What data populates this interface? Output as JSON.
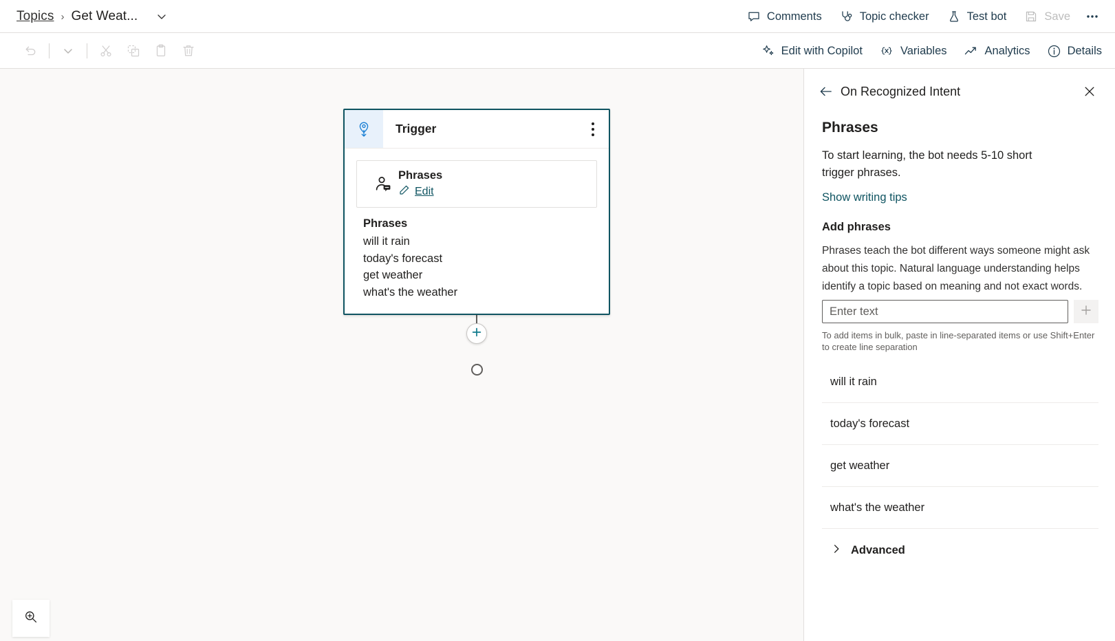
{
  "breadcrumb": {
    "root": "Topics",
    "separator": "›",
    "current": "Get Weat...",
    "chevron_icon": "chevron-down-icon"
  },
  "topbar": {
    "comments": {
      "label": "Comments",
      "icon": "comment-icon"
    },
    "topic_checker": {
      "label": "Topic checker",
      "icon": "stethoscope-icon"
    },
    "test_bot": {
      "label": "Test bot",
      "icon": "flask-icon"
    },
    "save": {
      "label": "Save",
      "icon": "save-icon",
      "disabled": true
    },
    "overflow": {
      "label": "•••",
      "icon": "more-horizontal-icon"
    }
  },
  "toolbar": {
    "undo": {
      "icon": "undo-icon",
      "disabled": true
    },
    "undo_dropdown": {
      "icon": "chevron-down-icon",
      "disabled": true
    },
    "cut": {
      "icon": "scissors-icon",
      "disabled": true
    },
    "copy": {
      "icon": "copy-icon",
      "disabled": true
    },
    "paste": {
      "icon": "clipboard-icon",
      "disabled": true
    },
    "delete": {
      "icon": "trash-icon",
      "disabled": true
    },
    "edit_with_copilot": {
      "label": "Edit with Copilot",
      "icon": "sparkle-icon"
    },
    "variables": {
      "label": "Variables",
      "icon": "braces-x-icon"
    },
    "analytics": {
      "label": "Analytics",
      "icon": "trend-chart-icon"
    },
    "details": {
      "label": "Details",
      "icon": "info-circle-icon"
    }
  },
  "canvas": {
    "trigger_node": {
      "icon": "trigger-intent-icon",
      "title": "Trigger",
      "menu_icon": "more-vertical-icon",
      "subcard": {
        "icon": "person-message-icon",
        "title": "Phrases",
        "edit_label": "Edit",
        "edit_icon": "pencil-icon"
      },
      "phrases_title": "Phrases",
      "phrases": [
        "will it rain",
        "today's forecast",
        "get weather",
        "what's the weather"
      ]
    },
    "add_node_icon": "plus-icon",
    "end_node_icon": "circle-node-icon",
    "zoom_control_icon": "zoom-in-icon"
  },
  "panel": {
    "back_icon": "arrow-left-icon",
    "header_title": "On Recognized Intent",
    "close_icon": "close-icon",
    "section_title": "Phrases",
    "description": "To start learning, the bot needs 5-10 short trigger phrases.",
    "writing_tips_link": "Show writing tips",
    "add_phrases_title": "Add phrases",
    "add_phrases_description": "Phrases teach the bot different ways someone might ask about this topic. Natural language understanding helps identify a topic based on meaning and not exact words.",
    "input": {
      "value": "",
      "placeholder": "Enter text"
    },
    "add_button_icon": "plus-icon",
    "bulk_hint": "To add items in bulk, paste in line-separated items or use Shift+Enter to create line separation",
    "phrases": [
      "will it rain",
      "today's forecast",
      "get weather",
      "what's the weather"
    ],
    "advanced": {
      "label": "Advanced",
      "icon": "chevron-right-icon",
      "expanded": false
    }
  },
  "colors": {
    "accent_teal": "#0f5461",
    "link": "#0f5461",
    "trigger_icon_blue": "#1a7fd4",
    "trigger_icon_bg": "#e8f1fb",
    "canvas_bg": "#faf9f8",
    "disabled": "#bdbdbd"
  }
}
